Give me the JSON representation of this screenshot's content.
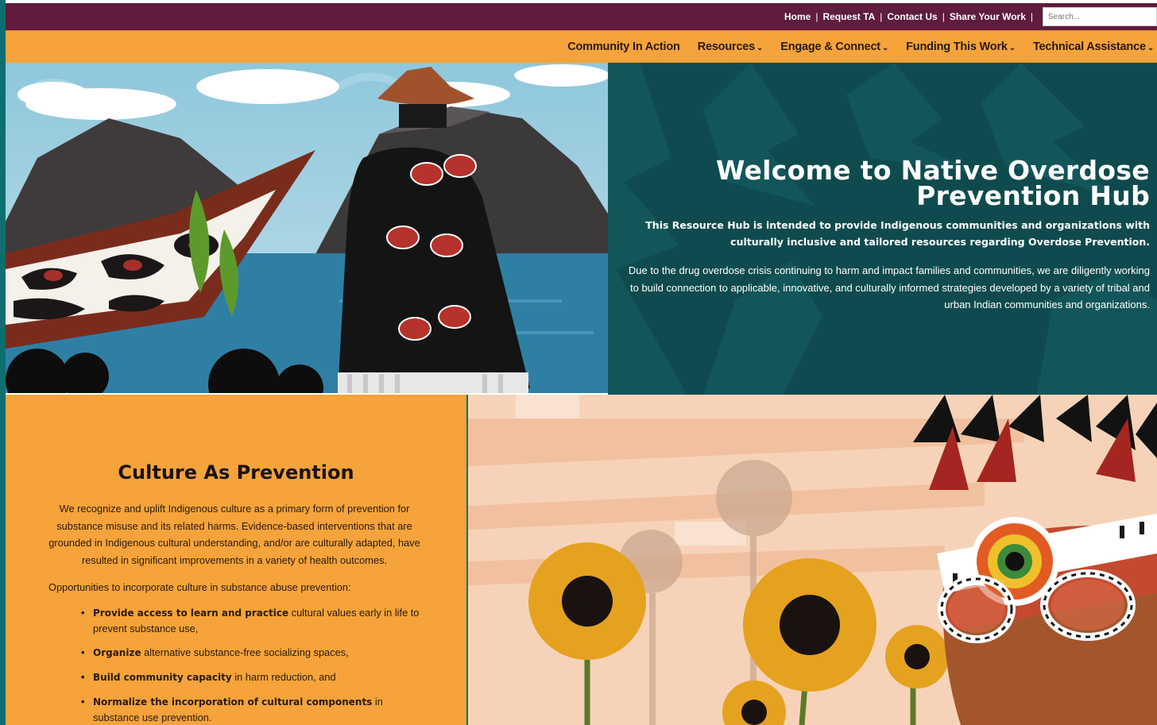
{
  "topbar": {
    "links": [
      "Home",
      "Request TA",
      "Contact Us",
      "Share Your Work"
    ],
    "search_placeholder": "Search..."
  },
  "nav": {
    "items": [
      {
        "label": "Community In Action",
        "dropdown": false
      },
      {
        "label": "Resources",
        "dropdown": true
      },
      {
        "label": "Engage & Connect",
        "dropdown": true
      },
      {
        "label": "Funding This Work",
        "dropdown": true
      },
      {
        "label": "Technical Assistance",
        "dropdown": true
      }
    ],
    "chevron": "⌄"
  },
  "hero": {
    "title": "Welcome to Native Overdose Prevention Hub",
    "subtitle": "This Resource Hub is intended to provide Indigenous communities and organizations with culturally inclusive and tailored resources regarding Overdose Prevention.",
    "body": "Due to the drug overdose crisis continuing to harm and impact families and communities, we are diligently working to build connection to applicable, innovative, and culturally informed strategies developed by a variety of tribal and urban Indian communities and organizations."
  },
  "culture": {
    "heading": "Culture As Prevention",
    "intro": "We recognize and uplift Indigenous culture as a primary form of prevention for substance misuse and its related harms. Evidence-based interventions that are grounded in Indigenous cultural understanding, and/or are culturally adapted, have resulted in significant improvements in a variety of health outcomes.",
    "lead": "Opportunities to incorporate culture in substance abuse prevention:",
    "items": [
      {
        "bold": "Provide access to learn and practice",
        "rest": " cultural values early in life to prevent substance use,"
      },
      {
        "bold": "Organize",
        "rest": " alternative substance-free socializing spaces,"
      },
      {
        "bold": "Build community capacity",
        "rest": " in harm reduction, and"
      },
      {
        "bold": "Normalize the incorporation of cultural components",
        "rest": " in substance use prevention."
      }
    ]
  },
  "colors": {
    "topbar": "#5f1c3c",
    "nav": "#f5a33a",
    "hero_panel": "#0f4b4e",
    "accent_teal": "#0f6e70"
  }
}
